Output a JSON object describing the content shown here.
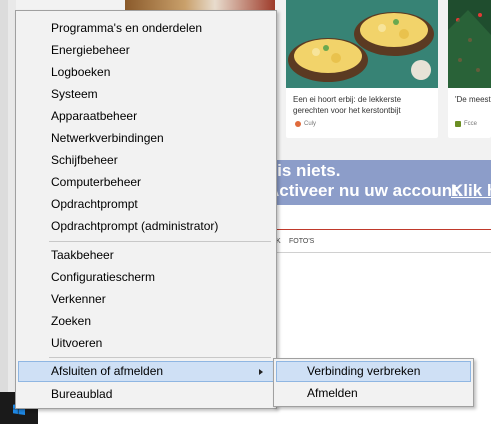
{
  "context_menu": {
    "groups": [
      {
        "items": [
          {
            "label": "Programma's en onderdelen"
          },
          {
            "label": "Energiebeheer"
          },
          {
            "label": "Logboeken"
          },
          {
            "label": "Systeem"
          },
          {
            "label": "Apparaatbeheer"
          },
          {
            "label": "Netwerkverbindingen"
          },
          {
            "label": "Schijfbeheer"
          },
          {
            "label": "Computerbeheer"
          },
          {
            "label": "Opdrachtprompt"
          },
          {
            "label": "Opdrachtprompt (administrator)"
          }
        ]
      },
      {
        "items": [
          {
            "label": "Taakbeheer"
          },
          {
            "label": "Configuratiescherm"
          },
          {
            "label": "Verkenner"
          },
          {
            "label": "Zoeken"
          },
          {
            "label": "Uitvoeren"
          }
        ]
      },
      {
        "items": [
          {
            "label": "Afsluiten of afmelden",
            "has_submenu": true,
            "highlighted": true
          },
          {
            "label": "Bureaublad"
          }
        ]
      }
    ]
  },
  "submenu": {
    "items": [
      {
        "label": "Verbinding verbreken",
        "highlighted": true
      },
      {
        "label": "Afmelden"
      }
    ]
  },
  "background": {
    "cards": [
      {
        "title": "Een ei hoort erbij: de lekkerste gerechten voor het kerstontbijt",
        "source": "Culy"
      },
      {
        "title": "'De meeste",
        "source": "Fcce"
      }
    ],
    "banner": {
      "line1": "Mis niets.",
      "line2": "Activeer nu uw account.",
      "link": "Klik h"
    },
    "nav": {
      "item1": "K",
      "item2": "FOTO'S"
    }
  },
  "colors": {
    "menu_bg": "#f2f2f2",
    "highlight_bg": "#cfe0f5",
    "highlight_border": "#8fb6e2",
    "banner_bg": "#8c9dc9"
  },
  "icons": [
    "chevron-right-icon",
    "windows-logo-icon"
  ]
}
